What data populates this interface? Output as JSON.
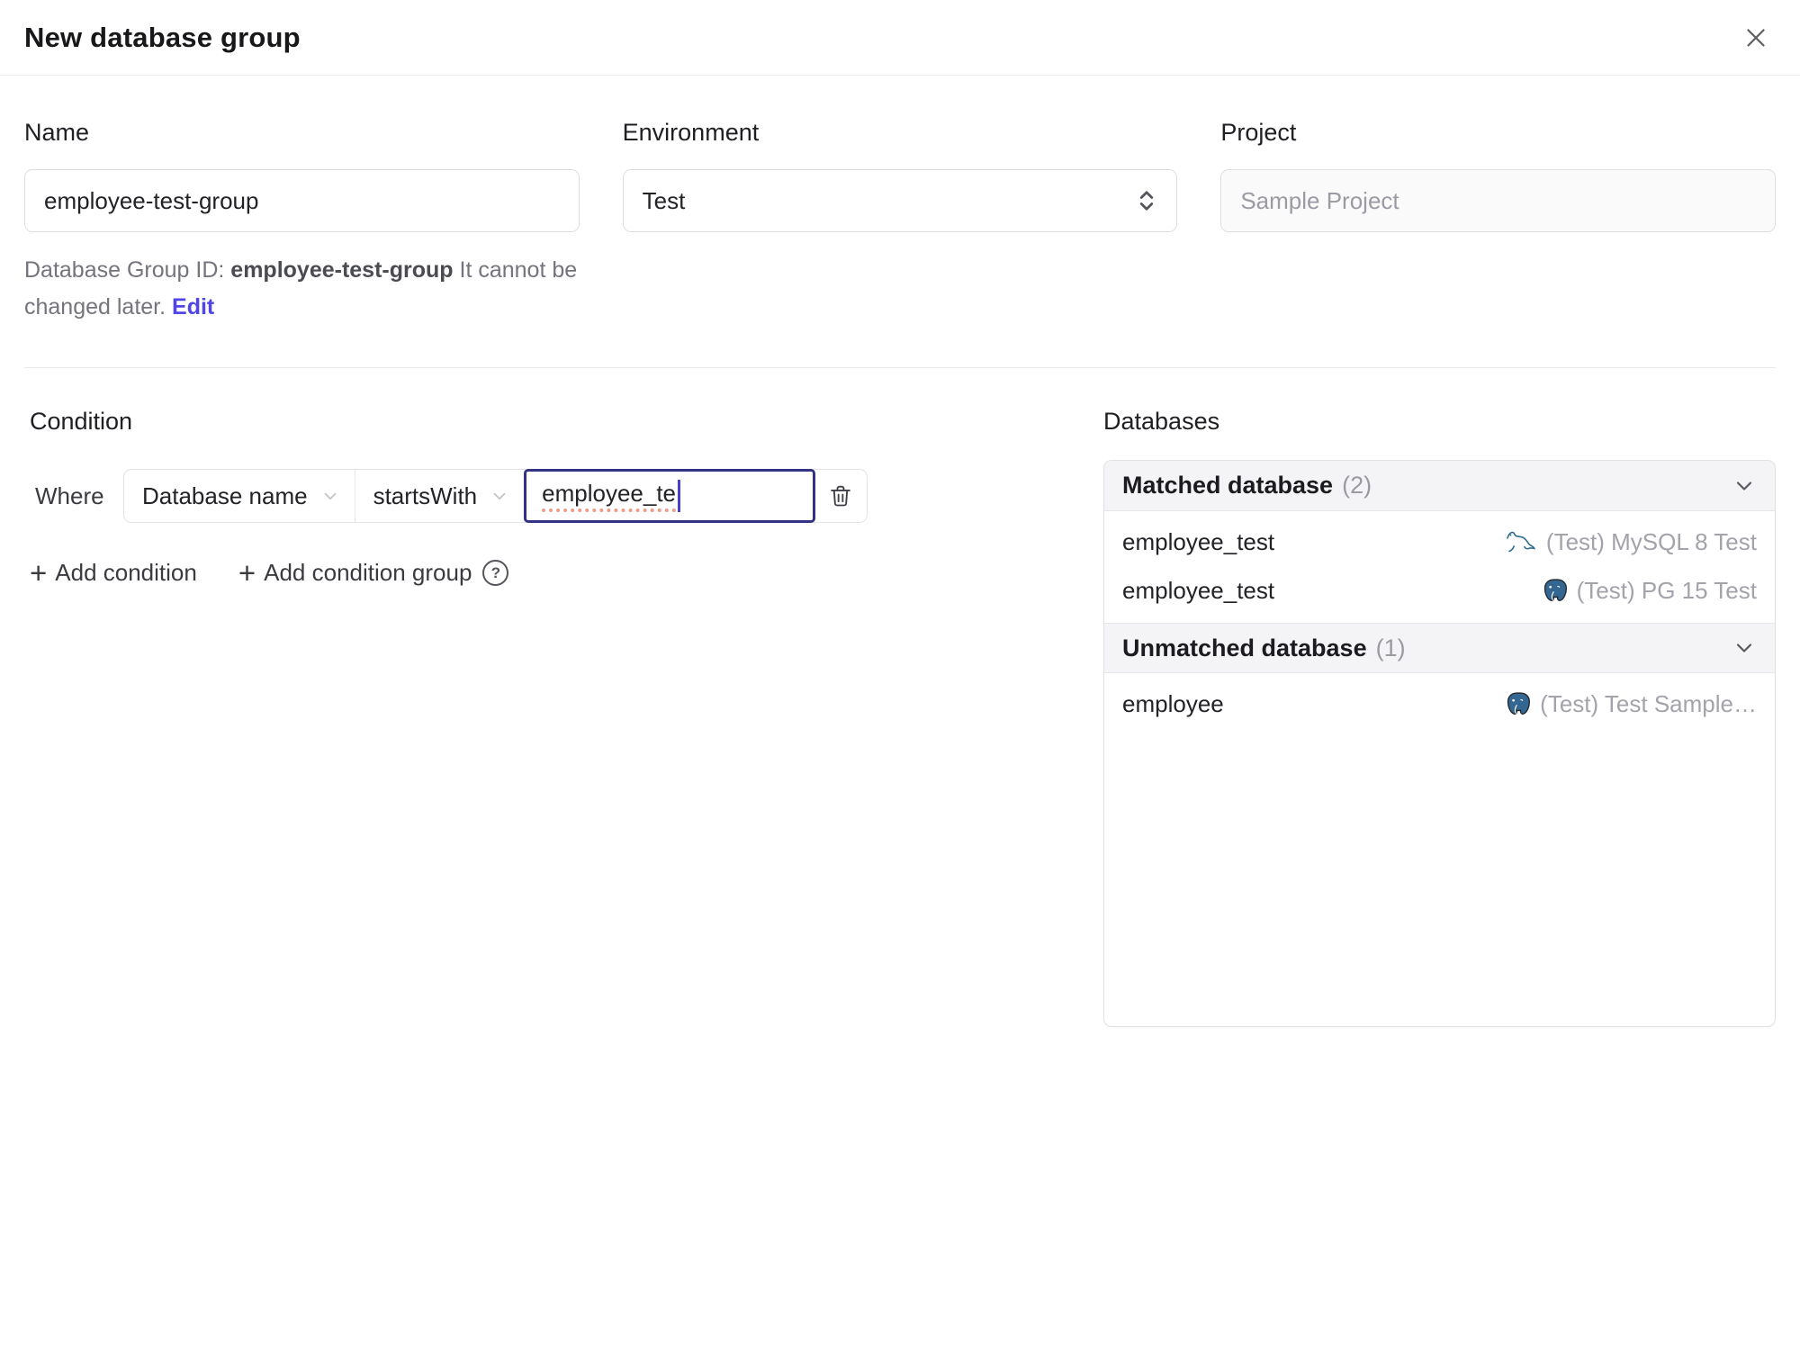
{
  "dialog": {
    "title": "New database group"
  },
  "icons": {
    "add": "+",
    "help": "?"
  },
  "form": {
    "name": {
      "label": "Name",
      "value": "employee-test-group"
    },
    "environment": {
      "label": "Environment",
      "value": "Test"
    },
    "project": {
      "label": "Project",
      "value": "Sample Project"
    },
    "id_hint": {
      "prefix": "Database Group ID: ",
      "id": "employee-test-group",
      "suffix": " It cannot be changed later. ",
      "edit_label": "Edit"
    }
  },
  "condition": {
    "heading": "Condition",
    "where_label": "Where",
    "field": "Database name",
    "operator": "startsWith",
    "value": "employee_te",
    "add_condition_label": "Add condition",
    "add_condition_group_label": "Add condition group"
  },
  "databases": {
    "heading": "Databases",
    "sections": [
      {
        "title": "Matched database",
        "count": "(2)",
        "rows": [
          {
            "name": "employee_test",
            "engine": "mysql",
            "instance": "(Test) MySQL 8 Test"
          },
          {
            "name": "employee_test",
            "engine": "postgres",
            "instance": "(Test) PG 15 Test"
          }
        ]
      },
      {
        "title": "Unmatched database",
        "count": "(1)",
        "rows": [
          {
            "name": "employee",
            "engine": "postgres",
            "instance": "(Test) Test Sample…"
          }
        ]
      }
    ]
  },
  "colors": {
    "accent_link": "#4f46e5",
    "focus_border": "#343286",
    "spellcheck_underline": "#f09a8c",
    "panel_header_bg": "#f4f4f6",
    "border": "#e4e4e8",
    "muted_text": "#9ca3af",
    "mysql_icon": "#2c6e91",
    "postgres_icon": "#336791"
  }
}
